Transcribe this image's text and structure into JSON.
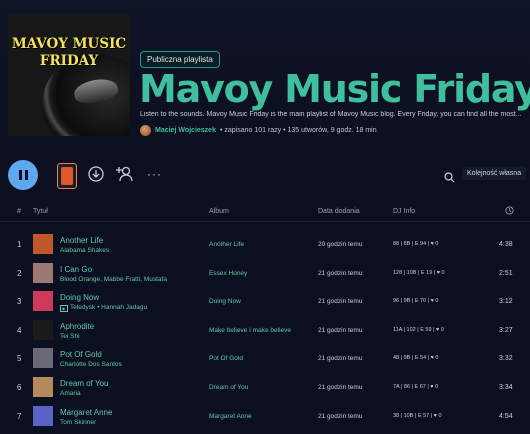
{
  "playlist": {
    "cover_line1": "MAVOY MUSIC",
    "cover_line2": "FRIDAY",
    "badge": "Publiczna playlista",
    "title": "Mavoy Music Friday",
    "description": "Listen to the sounds. Mavoy Music Friday is the main playlist of Mavoy Music blog. Every Friday, you can find all the most...",
    "owner": "Maciej Wojcieszek",
    "stats": "• zapisano 101 razy • 135 utworów, 9 godz. 18 min"
  },
  "controls": {
    "pause_icon": "pause-icon",
    "download_icon": "download-icon",
    "add_user_icon": "add-user-icon",
    "more_label": "···",
    "search_icon": "search-icon",
    "sort_label": "Kolejność własna"
  },
  "table": {
    "headers": {
      "num": "#",
      "title": "Tytuł",
      "album": "Album",
      "date": "Data dodania",
      "dj": "DJ Info",
      "duration_icon": "clock-icon"
    },
    "rows": [
      {
        "num": "1",
        "title": "Another Life",
        "artist": "Alabama Shakes",
        "album": "Another Life",
        "date": "20 godzin temu",
        "dj": "88 | 8B | E 94 | ♥ 0",
        "duration": "4:38",
        "video": false,
        "thumb": "#c2572b"
      },
      {
        "num": "2",
        "title": "I Can Go",
        "artist": "Blood Orange, Mabbe Fratti, Mustafa",
        "album": "Essex Honey",
        "date": "21 godzin temu",
        "dj": "128 | 10B | E 19 | ♥ 0",
        "duration": "2:51",
        "video": false,
        "thumb": "#9c7a72"
      },
      {
        "num": "3",
        "title": "Doing Now",
        "artist": "Teledysk • Hannah Jadagu",
        "album": "Doing Now",
        "date": "21 godzin temu",
        "dj": "96 | 9B | E 70 | ♥ 0",
        "duration": "3:12",
        "video": true,
        "thumb": "#d03a5a"
      },
      {
        "num": "4",
        "title": "Aphrodite",
        "artist": "Tei Shi",
        "album": "Make believe I make believe",
        "date": "21 godzin temu",
        "dj": "11A | 102 | E 59 | ♥ 0",
        "duration": "3:27",
        "video": false,
        "thumb": "#1a1a1a"
      },
      {
        "num": "5",
        "title": "Pot Of Gold",
        "artist": "Charlotte Dos Santos",
        "album": "Pot Of Gold",
        "date": "21 godzin temu",
        "dj": "48 | 9B | E 54 | ♥ 0",
        "duration": "3:32",
        "video": false,
        "thumb": "#6a6a74"
      },
      {
        "num": "6",
        "title": "Dream of You",
        "artist": "Amaria",
        "album": "Dream of You",
        "date": "21 godzin temu",
        "dj": "7A | 86 | E 67 | ♥ 0",
        "duration": "3:34",
        "video": false,
        "thumb": "#b58a5a"
      },
      {
        "num": "7",
        "title": "Margaret Anne",
        "artist": "Tom Skinner",
        "album": "Margaret Anne",
        "date": "21 godzin temu",
        "dj": "38 | 10B | E 57 | ♥ 0",
        "duration": "4:54",
        "video": false,
        "thumb": "#5a63c9"
      }
    ]
  }
}
